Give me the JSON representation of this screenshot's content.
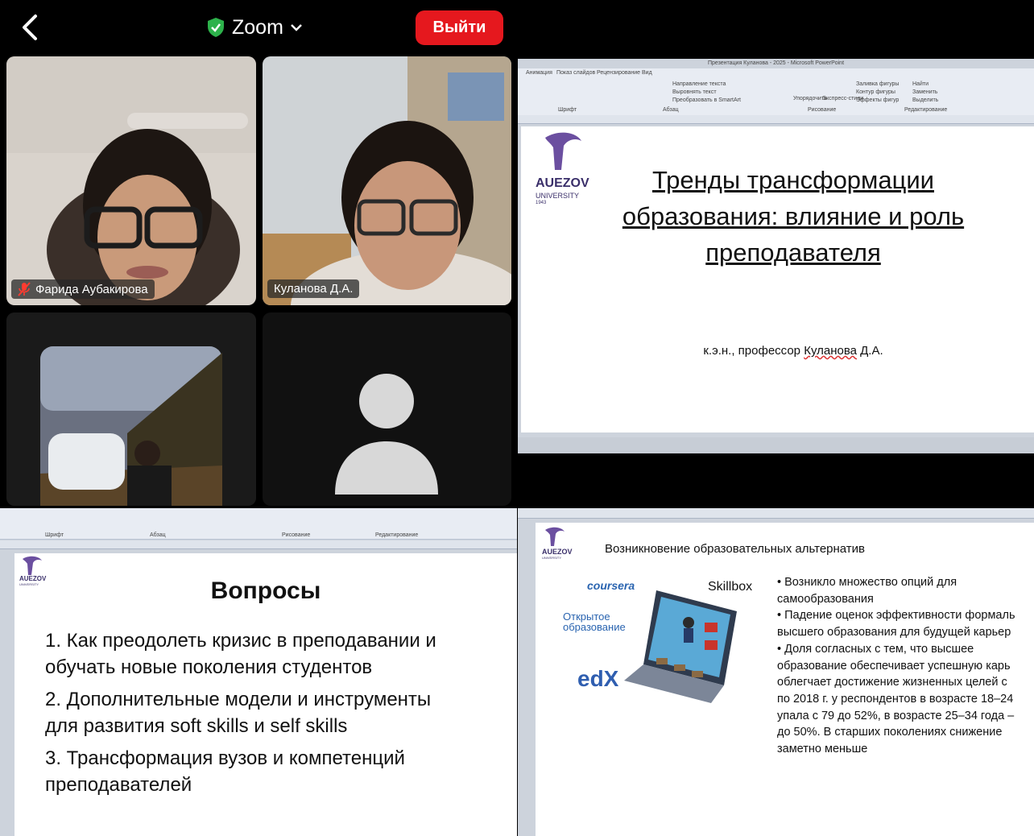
{
  "header": {
    "app_title": "Zoom",
    "exit_label": "Выйти"
  },
  "participants": [
    {
      "name": "Фарида Аубакирова",
      "muted": true
    },
    {
      "name": "Куланова Д.А.",
      "muted": false
    }
  ],
  "slide_main": {
    "window_title": "Презентация Куланова - 2025 - Microsoft PowerPoint",
    "ribbon_tabs": [
      "Анимация",
      "Показ слайдов",
      "Рецензирование",
      "Вид"
    ],
    "ribbon_groups": [
      "Шрифт",
      "Абзац",
      "Рисование",
      "Редактирование"
    ],
    "ribbon_items": [
      "Направление текста",
      "Выровнять текст",
      "Преобразовать в SmartArt",
      "Упорядочить",
      "Экспресс-стили",
      "Заливка фигуры",
      "Контур фигуры",
      "Эффекты фигур",
      "Найти",
      "Заменить",
      "Выделить"
    ],
    "logo_name": "AUEZOV",
    "logo_sub": "UNIVERSITY",
    "logo_year": "1943",
    "title_line1": "Тренды трансформации",
    "title_line2": "образования: влияние и роль",
    "title_line3": "преподавателя",
    "author_prefix": "к.э.н., профессор ",
    "author_name": "Куланова",
    "author_suffix": " Д.А."
  },
  "slide_questions": {
    "logo_name": "AUEZOV",
    "logo_sub": "UNIVERSITY",
    "title": "Вопросы",
    "q1a": "1. Как преодолеть кризис в преподавании и",
    "q1b": "обучать новые поколения студентов",
    "q2a": "2. Дополнительные модели и инструменты",
    "q2b": "для развития soft skills и self skills",
    "q3a": "3. Трансформация вузов и компетенций",
    "q3b": "преподавателей",
    "ribbon_groups": [
      "Шрифт",
      "Абзац",
      "Рисование",
      "Редактирование"
    ]
  },
  "slide_alternatives": {
    "logo_name": "AUEZOV",
    "logo_sub": "UNIVERSITY",
    "title": "Возникновение образовательных альтернатив",
    "brand_coursera": "coursera",
    "brand_skillbox": "Skillbox",
    "brand_open1": "Открытое",
    "brand_open2": "образование",
    "brand_edx": "edX",
    "lines": [
      "• Возникло множество опций для",
      "самообразования",
      "• Падение оценок эффективности формаль",
      "высшего образования для будущей карьер",
      "• Доля согласных с тем, что высшее",
      "образование обеспечивает успешную карь",
      "облегчает достижение жизненных целей с",
      "по 2018 г. у респондентов в возрасте 18–24",
      "упала с 79 до 52%, в возрасте 25–34 года –",
      "до 50%. В старших поколениях снижение",
      "заметно меньше"
    ]
  }
}
